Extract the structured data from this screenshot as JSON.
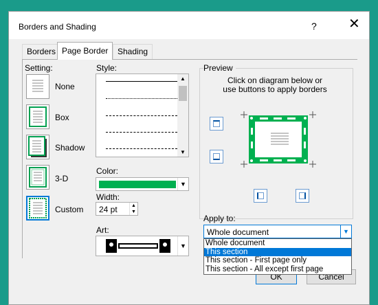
{
  "title": "Borders and Shading",
  "help": "?",
  "close": "✕",
  "tabs": [
    "Borders",
    "Page Border",
    "Shading"
  ],
  "setting": {
    "label": "Setting:",
    "items": [
      "None",
      "Box",
      "Shadow",
      "3-D",
      "Custom"
    ],
    "selected": "Custom"
  },
  "style": {
    "label": "Style:"
  },
  "color": {
    "label": "Color:",
    "value_color": "#00b050"
  },
  "width": {
    "label": "Width:",
    "value": "24 pt"
  },
  "art": {
    "label": "Art:"
  },
  "preview": {
    "label": "Preview",
    "instructions_line1": "Click on diagram below or",
    "instructions_line2": "use buttons to apply borders"
  },
  "apply_to": {
    "label": "Apply to:",
    "value": "Whole document",
    "options": [
      "Whole document",
      "This section",
      "This section - First page only",
      "This section - All except first page"
    ],
    "highlighted": "This section"
  },
  "buttons": {
    "ok": "OK",
    "cancel": "Cancel"
  }
}
